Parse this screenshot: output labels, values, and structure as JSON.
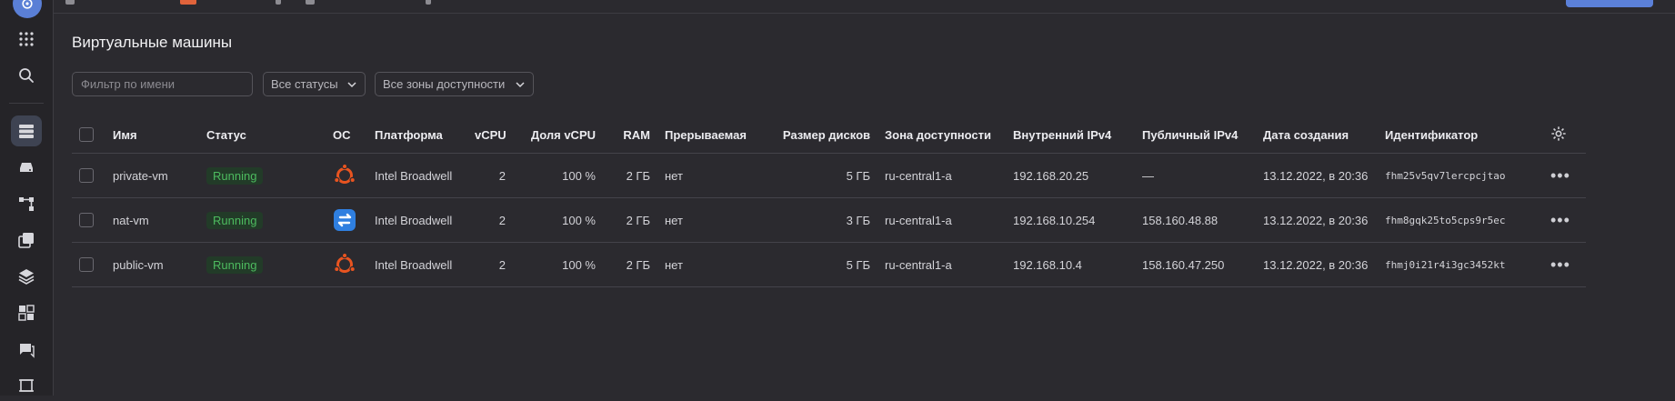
{
  "page_title": "Виртуальные машины",
  "filters": {
    "name_placeholder": "Фильтр по имени",
    "status_label": "Все статусы",
    "zones_label": "Все зоны доступности"
  },
  "table": {
    "columns": {
      "name": "Имя",
      "status": "Статус",
      "os": "ОС",
      "platform": "Платформа",
      "vcpu": "vCPU",
      "vcpu_share": "Доля vCPU",
      "ram": "RAM",
      "preemptible": "Прерываемая",
      "disk_size": "Размер дисков",
      "zone": "Зона доступности",
      "internal_ip": "Внутренний IPv4",
      "public_ip": "Публичный IPv4",
      "created": "Дата создания",
      "id": "Идентификатор"
    },
    "rows": [
      {
        "name": "private-vm",
        "status": "Running",
        "os_icon": "ubuntu-icon",
        "platform": "Intel Broadwell",
        "vcpu": "2",
        "vcpu_share": "100 %",
        "ram": "2 ГБ",
        "preemptible": "нет",
        "disk_size": "5 ГБ",
        "zone": "ru-central1-a",
        "internal_ip": "192.168.20.25",
        "public_ip": "—",
        "created": "13.12.2022, в 20:36",
        "id": "fhm25v5qv7lercpcjtao"
      },
      {
        "name": "nat-vm",
        "status": "Running",
        "os_icon": "nat-instance-icon",
        "platform": "Intel Broadwell",
        "vcpu": "2",
        "vcpu_share": "100 %",
        "ram": "2 ГБ",
        "preemptible": "нет",
        "disk_size": "3 ГБ",
        "zone": "ru-central1-a",
        "internal_ip": "192.168.10.254",
        "public_ip": "158.160.48.88",
        "created": "13.12.2022, в 20:36",
        "id": "fhm8gqk25to5cps9r5ec"
      },
      {
        "name": "public-vm",
        "status": "Running",
        "os_icon": "ubuntu-icon",
        "platform": "Intel Broadwell",
        "vcpu": "2",
        "vcpu_share": "100 %",
        "ram": "2 ГБ",
        "preemptible": "нет",
        "disk_size": "5 ГБ",
        "zone": "ru-central1-a",
        "internal_ip": "192.168.10.4",
        "public_ip": "158.160.47.250",
        "created": "13.12.2022, в 20:36",
        "id": "fhmj0i21r4i3gc3452kt"
      }
    ],
    "row_menu_glyph": "•••"
  },
  "colors": {
    "background": "#2b2a2f",
    "accent": "#5b80d9",
    "status_running": "#4dbb5f",
    "ubuntu_orange": "#e95420",
    "nat_blue": "#2f7fe0"
  }
}
